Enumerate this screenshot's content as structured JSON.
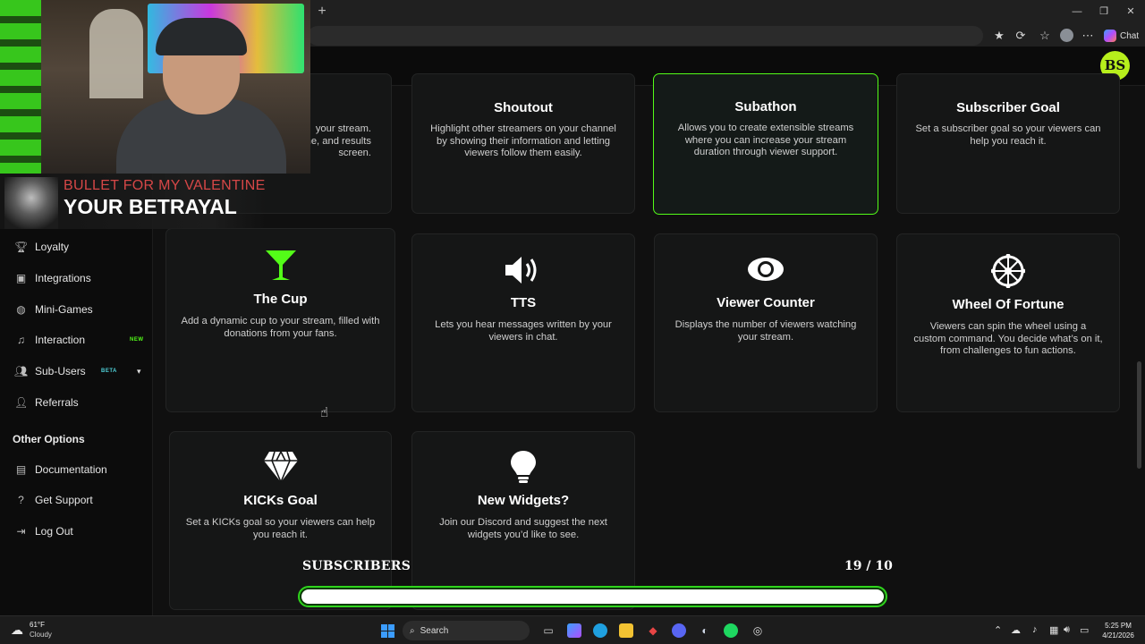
{
  "browser": {
    "new_tab_glyph": "+",
    "chat_label": "Chat",
    "window_controls": [
      "—",
      "❐",
      "✕"
    ]
  },
  "app": {
    "brand_initials": "BS"
  },
  "sidebar": {
    "items": [
      {
        "label": "Loyalty",
        "icon": "trophy-icon"
      },
      {
        "label": "Integrations",
        "icon": "plug-icon"
      },
      {
        "label": "Mini-Games",
        "icon": "gamepad-icon"
      },
      {
        "label": "Interaction",
        "icon": "music-icon",
        "badge": "NEW"
      },
      {
        "label": "Sub-Users",
        "icon": "users-icon",
        "badge": "BETA"
      },
      {
        "label": "Referrals",
        "icon": "user-plus-icon"
      }
    ],
    "other_heading": "Other Options",
    "other_items": [
      {
        "label": "Documentation",
        "icon": "book-icon"
      },
      {
        "label": "Get Support",
        "icon": "question-icon"
      },
      {
        "label": "Log Out",
        "icon": "logout-icon"
      }
    ]
  },
  "widgets": {
    "partial_card": {
      "desc_lines": [
        "your stream.",
        "he, and results",
        "screen."
      ]
    },
    "shoutout": {
      "title": "Shoutout",
      "desc": "Highlight other streamers on your channel by showing their information and letting viewers follow them easily."
    },
    "subathon": {
      "title": "Subathon",
      "desc": "Allows you to create extensible streams where you can increase your stream duration through viewer support."
    },
    "subscriber_goal": {
      "title": "Subscriber Goal",
      "desc": "Set a subscriber goal so your viewers can help you reach it."
    },
    "the_cup": {
      "title": "The Cup",
      "desc": "Add a dynamic cup to your stream, filled with donations from your fans."
    },
    "tts": {
      "title": "TTS",
      "desc": "Lets you hear messages written by your viewers in chat."
    },
    "viewer_counter": {
      "title": "Viewer Counter",
      "desc": "Displays the number of viewers watching your stream."
    },
    "wheel_of_fortune": {
      "title": "Wheel Of Fortune",
      "desc": "Viewers can spin the wheel using a custom command. You decide what’s on it, from challenges to fun actions."
    },
    "kicks_goal": {
      "title": "KICKs Goal",
      "desc": "Set a KICKs goal so your viewers can help you reach it."
    },
    "new_widgets": {
      "title": "New Widgets?",
      "desc": "Join our Discord and suggest the next widgets you’d like to see."
    }
  },
  "overlay": {
    "now_playing": {
      "artist": "BULLET FOR MY VALENTINE",
      "song": "YOUR BETRAYAL"
    },
    "subscribers": {
      "label": "SUBSCRIBERS",
      "count": "19 / 10",
      "progress_fraction": 1.0
    }
  },
  "taskbar": {
    "weather_temp": "61°F",
    "weather_desc": "Cloudy",
    "search_label": "Search",
    "time": "5:25 PM",
    "date": "4/21/2026"
  },
  "colors": {
    "accent": "#53fc18",
    "artist_red": "#d64747",
    "progress_border": "#2fd41d"
  }
}
